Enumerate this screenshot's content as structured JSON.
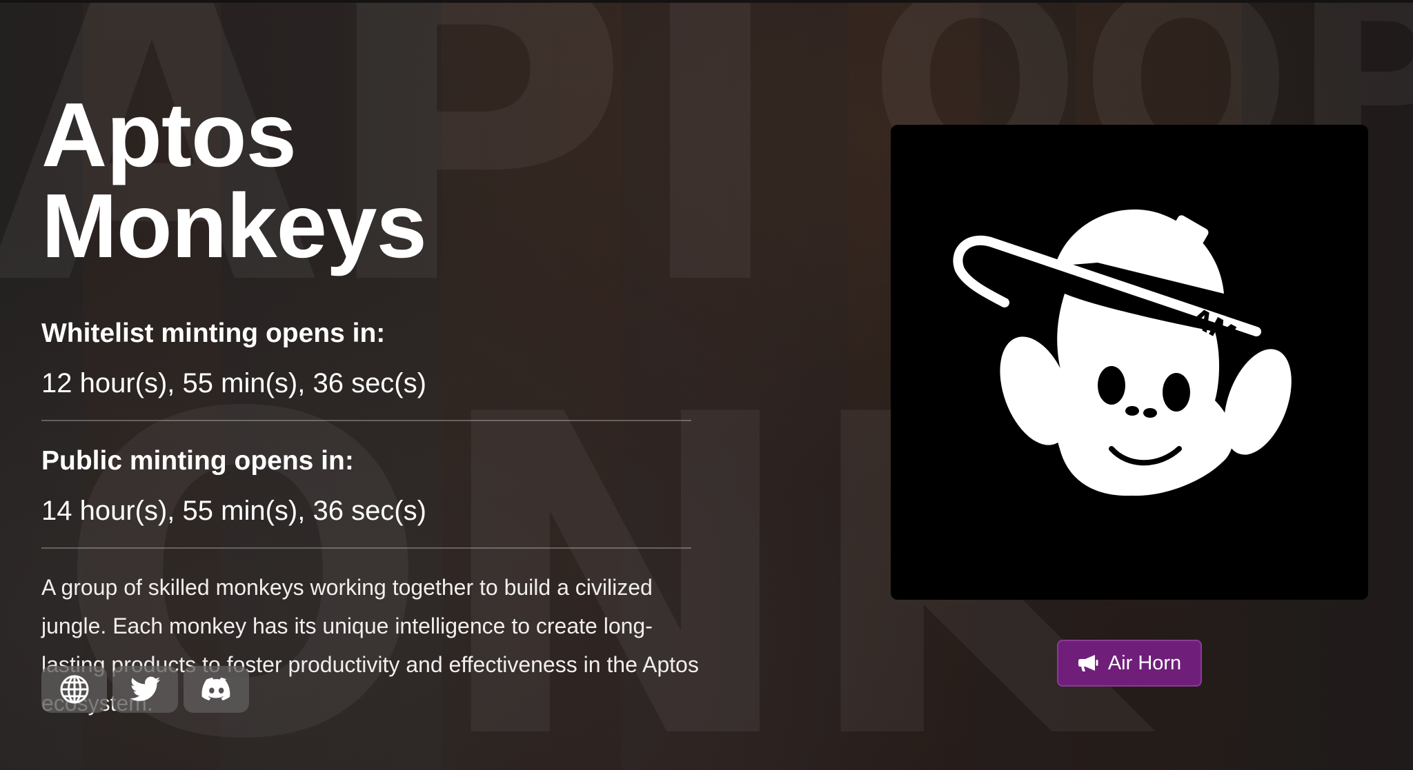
{
  "project": {
    "title": "Aptos Monkeys",
    "description": "A group of skilled monkeys working together to build a civilized jungle. Each monkey has its unique intelligence to create long-lasting products to foster productivity and effectiveness in the Aptos ecosystem."
  },
  "minting": {
    "whitelist": {
      "label": "Whitelist minting opens in:",
      "countdown": "12 hour(s), 55 min(s), 36 sec(s)"
    },
    "public": {
      "label": "Public minting opens in:",
      "countdown": "14 hour(s), 55 min(s), 36 sec(s)"
    }
  },
  "socials": [
    {
      "icon": "globe-icon"
    },
    {
      "icon": "twitter-icon"
    },
    {
      "icon": "discord-icon"
    }
  ],
  "artwork": {
    "logo_text": "AM"
  },
  "actions": {
    "air_horn_label": "Air Horn",
    "air_horn_icon": "megaphone-icon"
  },
  "colors": {
    "accent": "#6f1f7a",
    "text": "#ffffff",
    "social_button_bg": "#5f5c5c"
  }
}
